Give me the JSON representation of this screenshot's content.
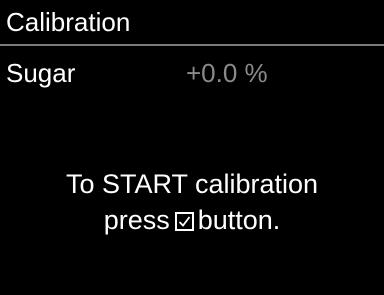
{
  "colors": {
    "background": "#000000",
    "text": "#ffffff",
    "value_text": "#8a8a8a",
    "divider": "#7a7a7a"
  },
  "header": {
    "title": "Calibration"
  },
  "parameter": {
    "label": "Sugar",
    "value": "+0.0 %"
  },
  "instructions": {
    "line1": "To START calibration",
    "line2_prefix": "press",
    "line2_icon": "checkbox-check-icon",
    "line2_suffix": "button."
  }
}
